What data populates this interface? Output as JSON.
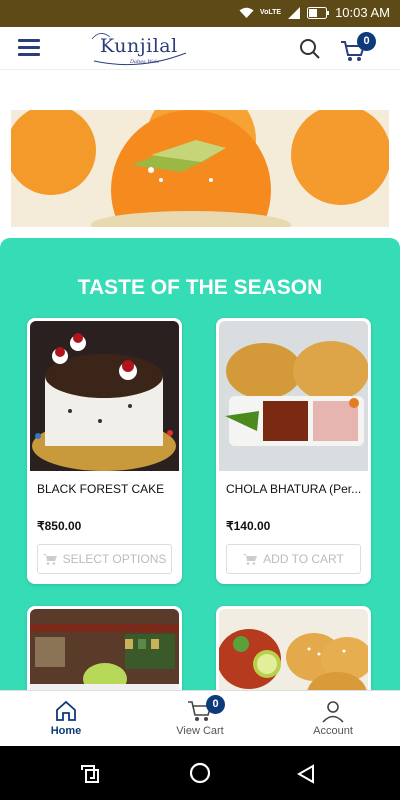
{
  "status_bar": {
    "network_label": "VoLTE",
    "time": "10:03 AM"
  },
  "header": {
    "logo_name": "Kunjilal",
    "logo_tagline": "Dabes Wale",
    "cart_count": "0"
  },
  "section": {
    "title": "TASTE OF THE SEASON"
  },
  "products": [
    {
      "name": "BLACK FOREST CAKE",
      "price": "₹850.00",
      "action": "SELECT OPTIONS"
    },
    {
      "name": "CHOLA BHATURA (Per...",
      "price": "₹140.00",
      "action": "ADD TO CART"
    }
  ],
  "bottom_nav": [
    {
      "label": "Home",
      "icon": "home-icon"
    },
    {
      "label": "View Cart",
      "icon": "cart-icon",
      "badge": "0"
    },
    {
      "label": "Account",
      "icon": "user-icon"
    }
  ],
  "colors": {
    "accent": "#35dcb6",
    "brand": "#2c3e7a",
    "badge": "#0d3a7a",
    "status_bar": "#5d4a16"
  }
}
